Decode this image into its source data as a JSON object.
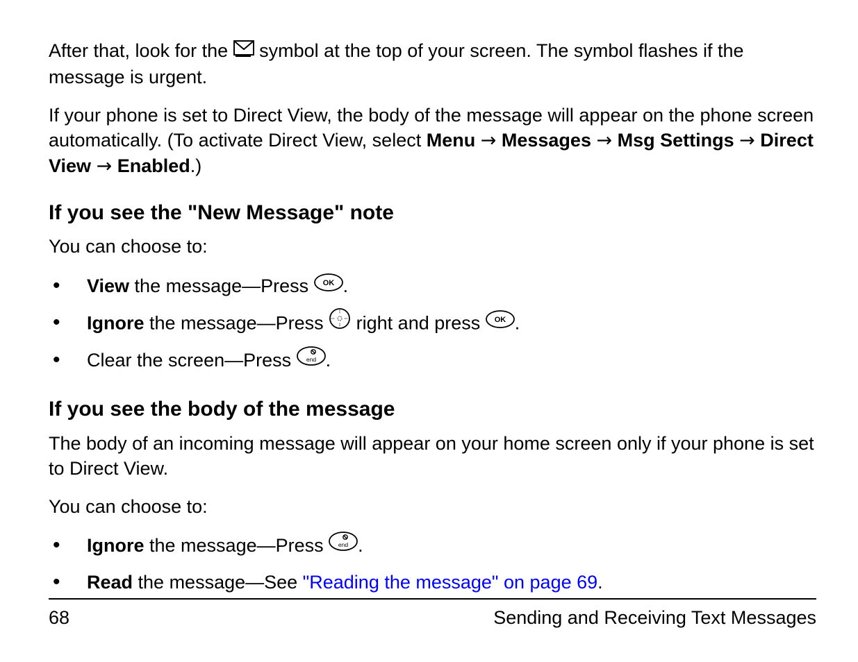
{
  "para1": {
    "before_icon": "After that, look for the ",
    "after_icon": " symbol at the top of your screen. The symbol flashes if the message is urgent."
  },
  "para2": {
    "lead": "If your phone is set to Direct View, the body of the message will appear on the phone screen automatically. (To activate Direct View, select ",
    "menu": "Menu",
    "messages": "Messages",
    "msg_settings": "Msg Settings",
    "direct_view": "Direct View",
    "enabled": "Enabled",
    "tail": ".)"
  },
  "heading_a": "If you see the \"New Message\" note",
  "lead_a": "You can choose to:",
  "list_a": {
    "item1": {
      "bold": "View",
      "mid": " the message—Press ",
      "tail": "."
    },
    "item2": {
      "bold": "Ignore",
      "mid": " the message—Press ",
      "mid2": " right and press ",
      "tail": "."
    },
    "item3": {
      "lead": "Clear the screen—Press ",
      "tail": "."
    }
  },
  "heading_b": "If you see the body of the message",
  "para_b": "The body of an incoming message will appear on your home screen only if your phone is set to Direct View.",
  "lead_b": "You can choose to:",
  "list_b": {
    "item1": {
      "bold": "Ignore",
      "mid": " the message—Press ",
      "tail": "."
    },
    "item2": {
      "bold": "Read",
      "mid": " the message—See ",
      "link": "\"Reading the message\" on page 69",
      "tail": "."
    }
  },
  "footer": {
    "page": "68",
    "section": "Sending and Receiving Text Messages"
  },
  "arrow": "→"
}
